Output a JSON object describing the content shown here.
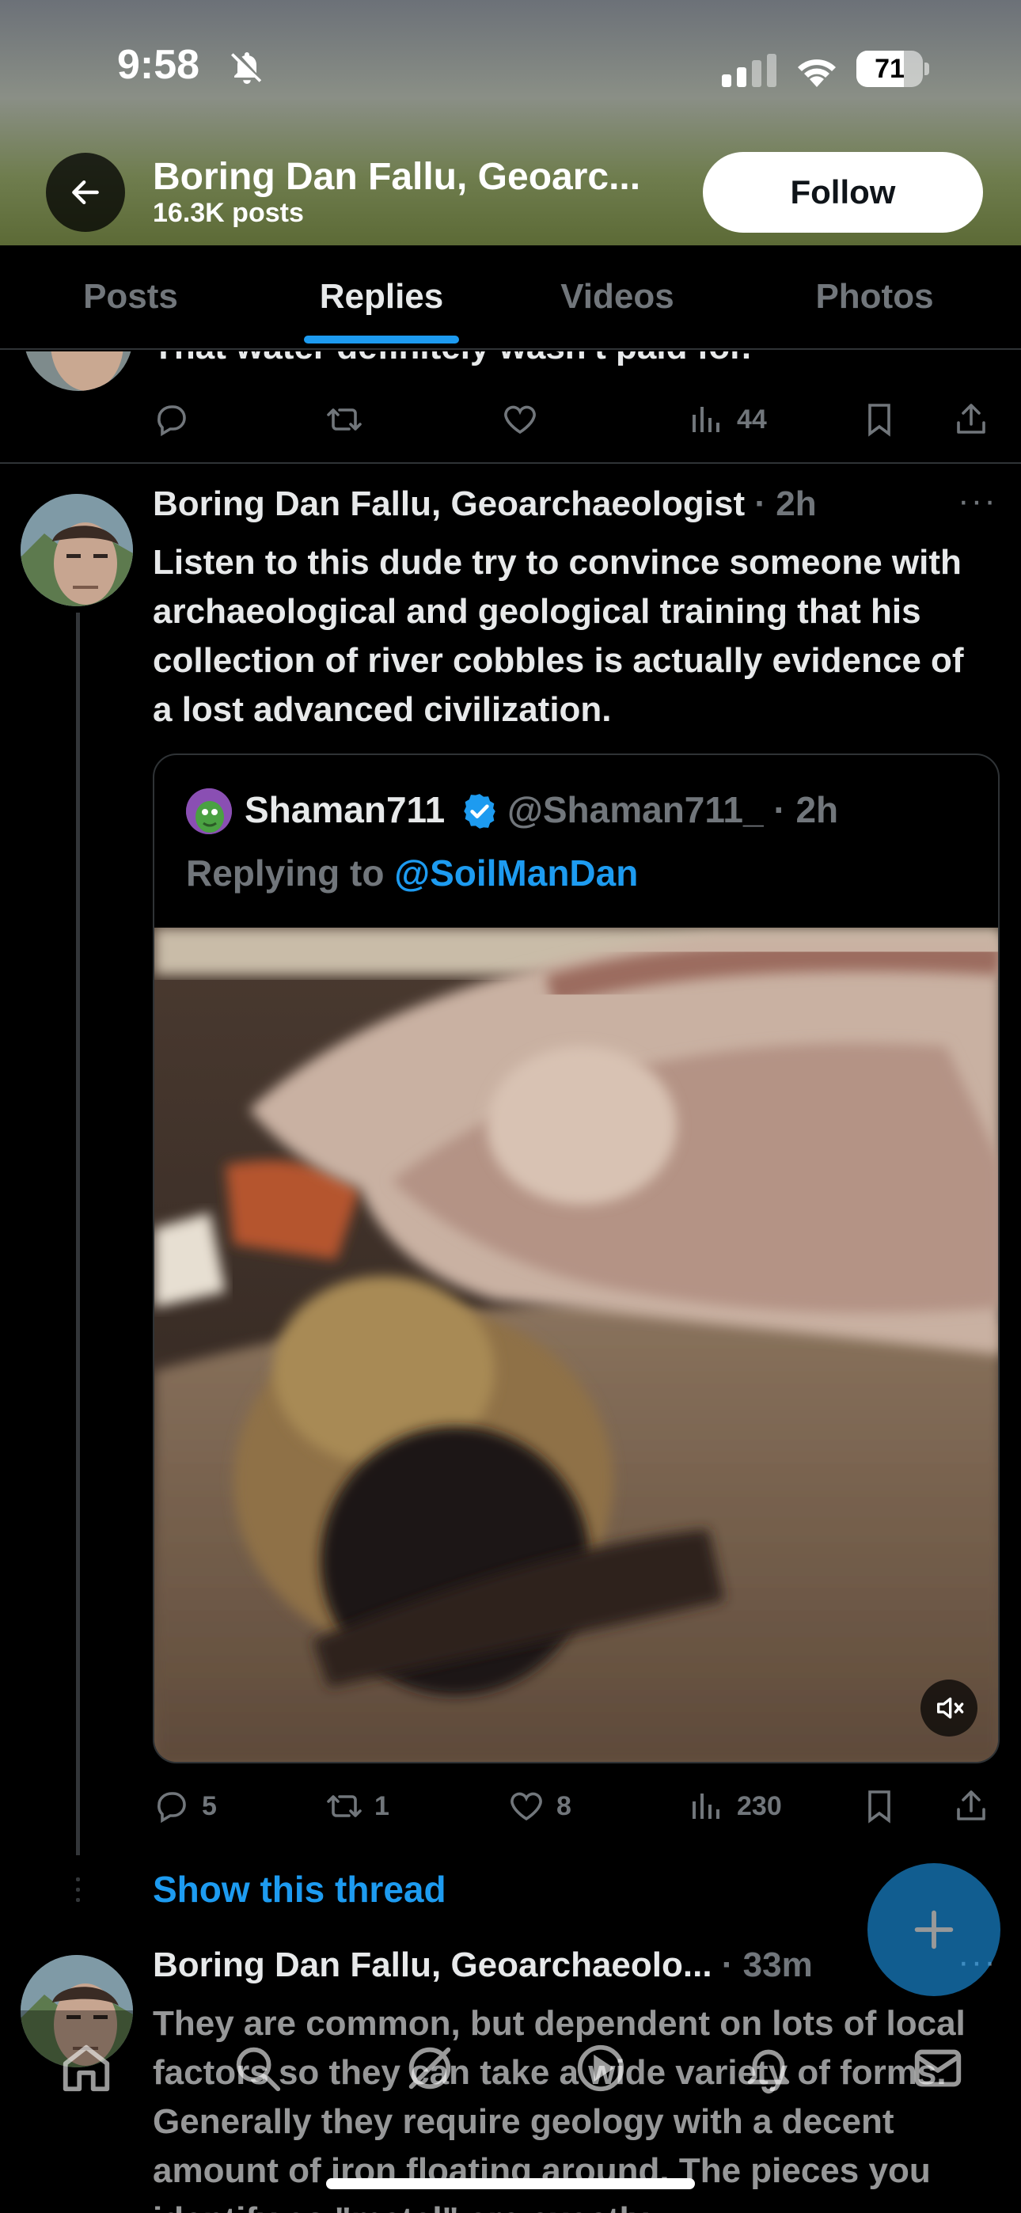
{
  "status_bar": {
    "time": "9:58",
    "battery": "71",
    "battery_level": 0.71
  },
  "header": {
    "title": "Boring Dan Fallu, Geoarc...",
    "subtitle": "16.3K posts",
    "follow_label": "Follow"
  },
  "tabs": [
    {
      "label": "Posts",
      "active": false
    },
    {
      "label": "Replies",
      "active": true
    },
    {
      "label": "Videos",
      "active": false
    },
    {
      "label": "Photos",
      "active": false
    }
  ],
  "previous_post": {
    "text": "That water definitely wasn't paid for.",
    "views": "44"
  },
  "main_post": {
    "author": "Boring Dan Fallu, Geoarchaeologist",
    "time": "· 2h",
    "text": "Listen to this dude try to convince someone with archaeological and geological training that his collection of river cobbles is actually evidence of a lost advanced civilization.",
    "quote": {
      "name": "Shaman711",
      "handle": "@Shaman711_ · 2h",
      "replying_prefix": "Replying to",
      "replying_to": "@SoilManDan"
    },
    "stats": {
      "replies": "5",
      "reposts": "1",
      "likes": "8",
      "views": "230"
    },
    "show_thread": "Show this thread"
  },
  "next_post": {
    "author": "Boring Dan Fallu, Geoarchaeolo...",
    "time": "· 33m",
    "text": "They are common, but dependent on lots of local factors so they can take a wide variety of forms. Generally they require geology with a decent amount of iron floating around. The pieces you identify as \"metal\" are exactly"
  },
  "colors": {
    "accent": "#1d9bf0",
    "muted": "#71767b",
    "text": "#e7e9ea",
    "divider": "#2f3336"
  },
  "icons": [
    "back-arrow-icon",
    "bell-slash-icon",
    "reply-icon",
    "repost-icon",
    "like-icon",
    "views-icon",
    "bookmark-icon",
    "share-icon",
    "verified-icon",
    "mute-icon",
    "compose-plus-icon",
    "home-icon",
    "search-icon",
    "grok-icon",
    "spaces-icon",
    "notifications-icon",
    "messages-icon"
  ]
}
